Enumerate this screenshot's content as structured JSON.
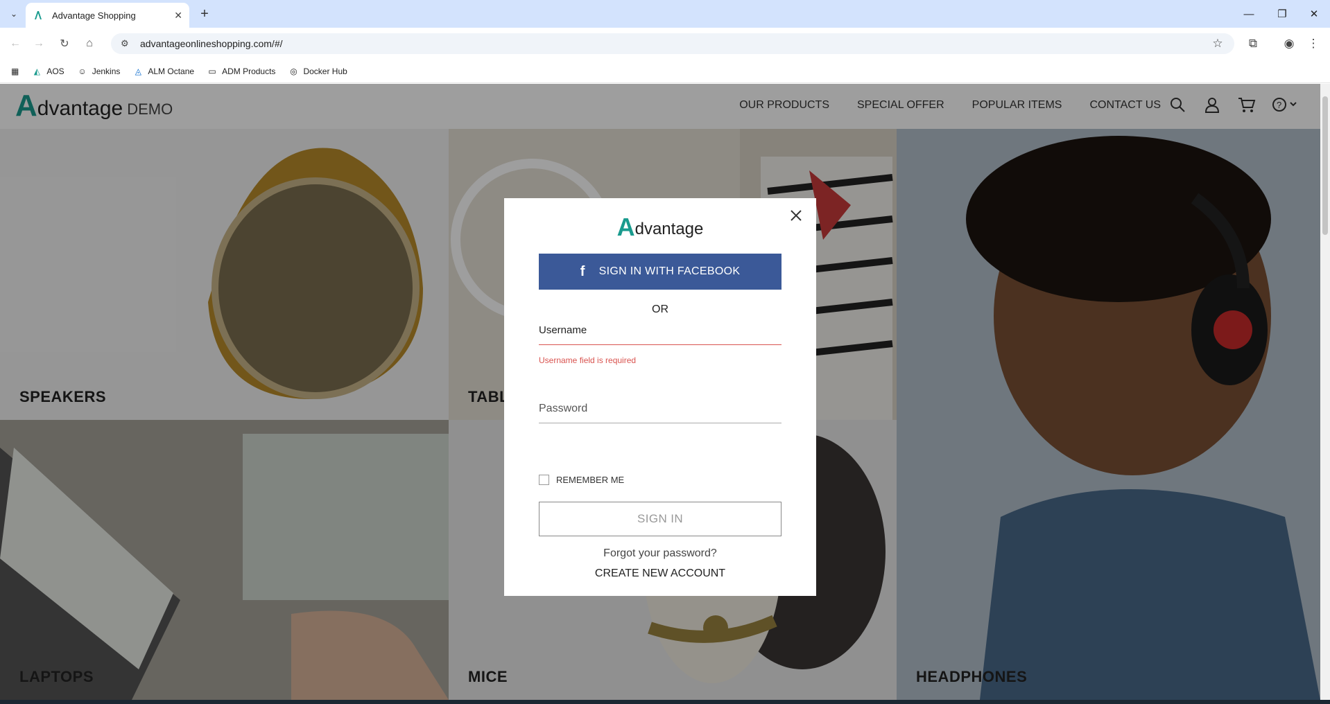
{
  "browser": {
    "tab_title": "Advantage Shopping",
    "url": "advantageonlineshopping.com/#/",
    "bookmarks": [
      "AOS",
      "Jenkins",
      "ALM Octane",
      "ADM Products",
      "Docker Hub"
    ]
  },
  "site": {
    "logo_letter": "A",
    "logo_rest": "dvantage",
    "logo_demo": "DEMO",
    "nav": [
      "OUR PRODUCTS",
      "SPECIAL OFFER",
      "POPULAR ITEMS",
      "CONTACT US"
    ],
    "tiles": {
      "speakers": "SPEAKERS",
      "tablets": "TABLETS",
      "laptops": "LAPTOPS",
      "mice": "MICE",
      "headphones": "HEADPHONES"
    }
  },
  "modal": {
    "logo_letter": "A",
    "logo_rest": "dvantage",
    "facebook_label": "SIGN IN WITH FACEBOOK",
    "or_label": "OR",
    "username_label": "Username",
    "username_error": "Username field is required",
    "password_label": "Password",
    "remember_label": "REMEMBER ME",
    "signin_label": "SIGN IN",
    "forgot_label": "Forgot your password?",
    "create_label": "CREATE NEW ACCOUNT"
  },
  "colors": {
    "brand": "#1a9b8e",
    "facebook": "#3b5998",
    "error": "#d9534f"
  }
}
